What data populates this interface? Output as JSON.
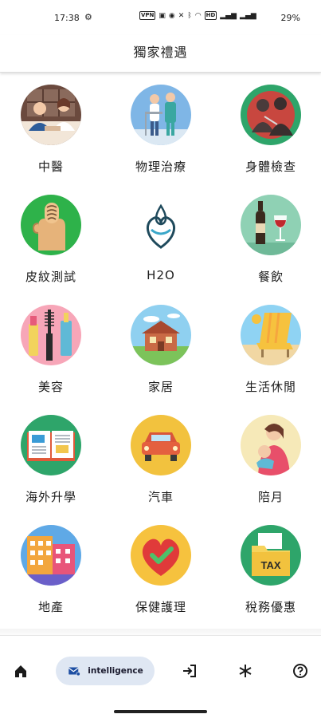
{
  "status": {
    "time": "17:38",
    "vpn": "VPN",
    "hd": "HD",
    "battery": "29%"
  },
  "header": {
    "title": "獨家禮遇"
  },
  "tiles": [
    {
      "label": "中醫",
      "icon": "doctor-consult-icon"
    },
    {
      "label": "物理治療",
      "icon": "physiotherapy-icon"
    },
    {
      "label": "身體檢查",
      "icon": "health-check-icon"
    },
    {
      "label": "皮紋測試",
      "icon": "fingerprint-icon"
    },
    {
      "label": "H2O",
      "icon": "water-heart-logo-icon"
    },
    {
      "label": "餐飲",
      "icon": "wine-icon"
    },
    {
      "label": "美容",
      "icon": "makeup-icon"
    },
    {
      "label": "家居",
      "icon": "house-icon"
    },
    {
      "label": "生活休閒",
      "icon": "beach-chair-icon"
    },
    {
      "label": "海外升學",
      "icon": "open-book-icon"
    },
    {
      "label": "汽車",
      "icon": "car-icon"
    },
    {
      "label": "陪月",
      "icon": "mother-baby-icon"
    },
    {
      "label": "地產",
      "icon": "building-icon"
    },
    {
      "label": "保健護理",
      "icon": "heart-check-icon"
    },
    {
      "label": "稅務優惠",
      "icon": "tax-folder-icon"
    }
  ],
  "tax_text": "TAX",
  "bottom_nav": {
    "pill_label": "intelligence",
    "items": [
      "home-icon",
      "intelligence-icon",
      "login-icon",
      "snowflake-icon",
      "help-icon"
    ]
  }
}
